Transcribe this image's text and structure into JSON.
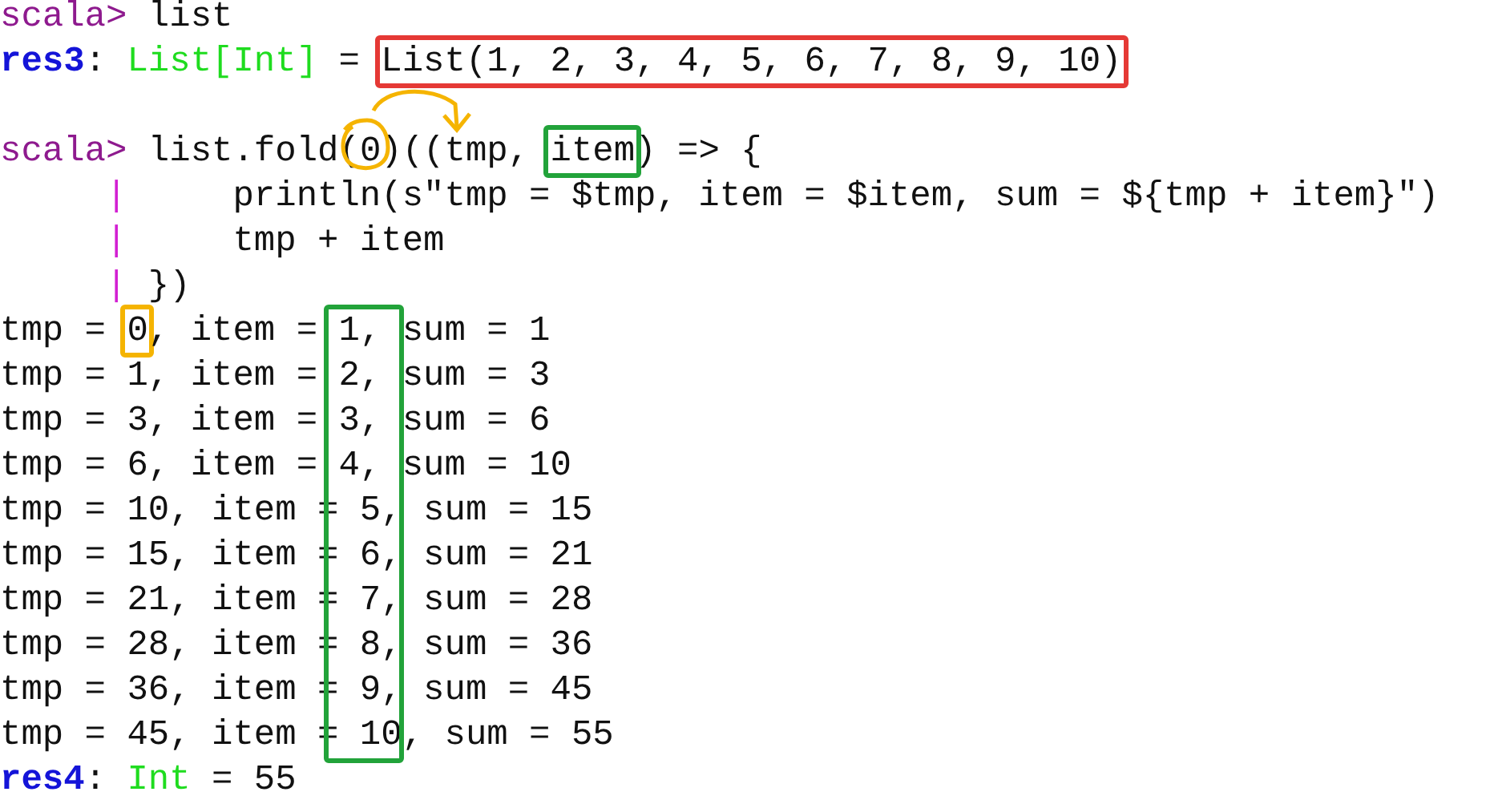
{
  "terminal": {
    "lines": [
      {
        "kind": "text",
        "segments": [
          {
            "kind": "prompt",
            "text": "scala>"
          },
          {
            "kind": "code",
            "text": " list"
          }
        ]
      },
      {
        "kind": "text",
        "segments": [
          {
            "kind": "result-name",
            "text": "res3"
          },
          {
            "kind": "code",
            "text": ": "
          },
          {
            "kind": "type",
            "text": "List[Int]"
          },
          {
            "kind": "code",
            "text": " = "
          },
          {
            "kind": "code",
            "text": "List(1, 2, 3, 4, 5, 6, 7, 8, 9, 10)",
            "box": {
              "color": "#e53935"
            }
          }
        ]
      },
      {
        "kind": "blank"
      },
      {
        "kind": "text",
        "segments": [
          {
            "kind": "prompt",
            "text": "scala>"
          },
          {
            "kind": "code",
            "text": " list.fold("
          },
          {
            "kind": "code",
            "text": "0"
          },
          {
            "kind": "code",
            "text": ")((tmp, "
          },
          {
            "kind": "code",
            "text": "item",
            "box": {
              "color": "#22a33a"
            }
          },
          {
            "kind": "code",
            "text": ") => {"
          }
        ]
      },
      {
        "kind": "continuation",
        "segments": [
          {
            "kind": "pipe",
            "text": "|"
          },
          {
            "kind": "code",
            "text": "     println(s\"tmp = $tmp, item = $item, sum = ${tmp + item}\")"
          }
        ]
      },
      {
        "kind": "continuation",
        "segments": [
          {
            "kind": "pipe",
            "text": "|"
          },
          {
            "kind": "code",
            "text": "     tmp + item"
          }
        ]
      },
      {
        "kind": "continuation",
        "segments": [
          {
            "kind": "pipe",
            "text": "|"
          },
          {
            "kind": "code",
            "text": " })"
          }
        ]
      },
      {
        "kind": "text",
        "segments": [
          {
            "kind": "code",
            "text": "tmp = "
          },
          {
            "kind": "code",
            "text": "0",
            "box": {
              "color": "#f5b400"
            }
          },
          {
            "kind": "code",
            "text": ", item = 1, sum = 1"
          }
        ]
      },
      {
        "kind": "text",
        "segments": [
          {
            "kind": "code",
            "text": "tmp = 1, item = 2, sum = 3"
          }
        ]
      },
      {
        "kind": "text",
        "segments": [
          {
            "kind": "code",
            "text": "tmp = 3, item = 3, sum = 6"
          }
        ]
      },
      {
        "kind": "text",
        "segments": [
          {
            "kind": "code",
            "text": "tmp = 6, item = 4, sum = 10"
          }
        ]
      },
      {
        "kind": "text",
        "segments": [
          {
            "kind": "code",
            "text": "tmp = 10, item = 5, sum = 15"
          }
        ]
      },
      {
        "kind": "text",
        "segments": [
          {
            "kind": "code",
            "text": "tmp = 15, item = 6, sum = 21"
          }
        ]
      },
      {
        "kind": "text",
        "segments": [
          {
            "kind": "code",
            "text": "tmp = 21, item = 7, sum = 28"
          }
        ]
      },
      {
        "kind": "text",
        "segments": [
          {
            "kind": "code",
            "text": "tmp = 28, item = 8, sum = 36"
          }
        ]
      },
      {
        "kind": "text",
        "segments": [
          {
            "kind": "code",
            "text": "tmp = 36, item = 9, sum = 45"
          }
        ]
      },
      {
        "kind": "text",
        "segments": [
          {
            "kind": "code",
            "text": "tmp = 45, item = 10, sum = 55"
          }
        ]
      },
      {
        "kind": "text",
        "segments": [
          {
            "kind": "result-name",
            "text": "res4"
          },
          {
            "kind": "code",
            "text": ": "
          },
          {
            "kind": "type",
            "text": "Int"
          },
          {
            "kind": "code",
            "text": " = 55"
          }
        ]
      }
    ],
    "annotations": [
      {
        "kind": "circle-arrow",
        "color": "#f5b400"
      },
      {
        "kind": "column-box",
        "color": "#22a33a"
      }
    ]
  }
}
